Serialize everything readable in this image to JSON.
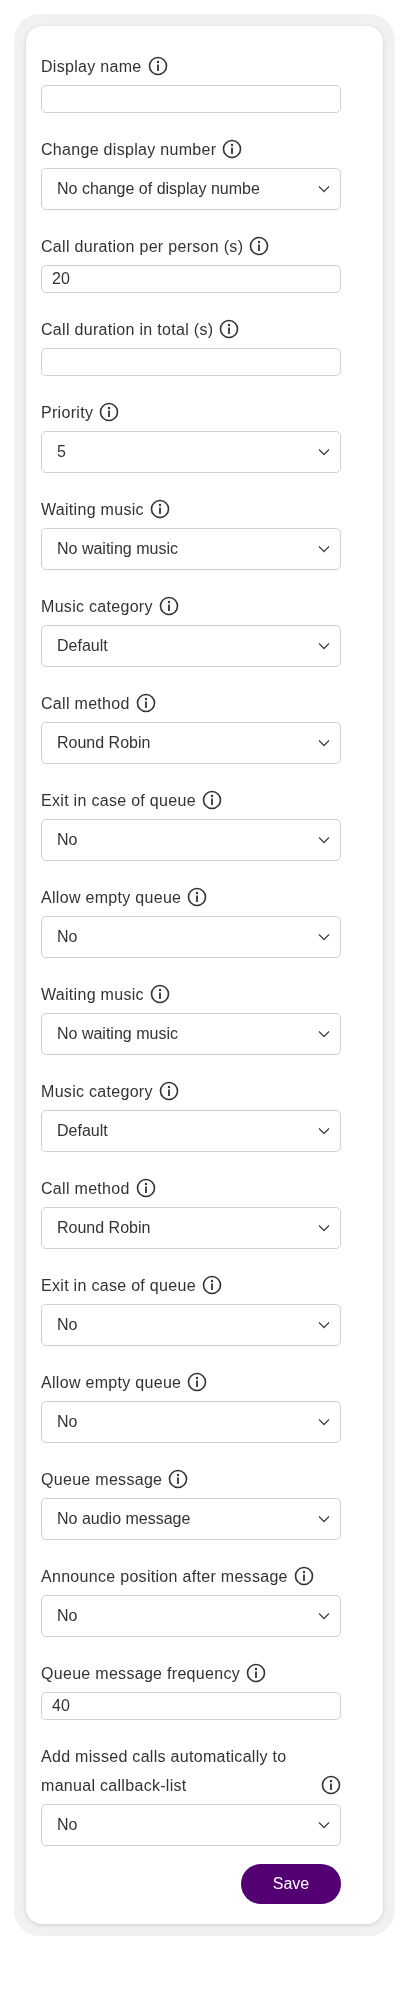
{
  "fields": [
    {
      "label": "Display name",
      "kind": "text"
    },
    {
      "label": "Change display number",
      "kind": "select",
      "value": "No change of display numbe"
    },
    {
      "label": "Call duration per person (s)",
      "kind": "text",
      "value": "20"
    },
    {
      "label": "Call duration in total (s)",
      "kind": "text"
    },
    {
      "label": "Priority",
      "kind": "select",
      "value": "5"
    },
    {
      "label": "Waiting music",
      "kind": "select",
      "value": "No waiting music"
    },
    {
      "label": "Music category",
      "kind": "select",
      "value": "Default"
    },
    {
      "label": "Call method",
      "kind": "select",
      "value": "Round Robin"
    },
    {
      "label": "Exit in case of queue",
      "kind": "select",
      "value": "No"
    },
    {
      "label": "Allow empty queue",
      "kind": "select",
      "value": "No"
    },
    {
      "label": "Waiting music",
      "kind": "select",
      "value": "No waiting music"
    },
    {
      "label": "Music category",
      "kind": "select",
      "value": "Default"
    },
    {
      "label": "Call method",
      "kind": "select",
      "value": "Round Robin"
    },
    {
      "label": "Exit in case of queue",
      "kind": "select",
      "value": "No"
    },
    {
      "label": "Allow empty queue",
      "kind": "select",
      "value": "No"
    },
    {
      "label": "Queue message",
      "kind": "select",
      "value": "No audio message"
    },
    {
      "label": "Announce position after message",
      "kind": "select",
      "value": "No"
    },
    {
      "label": "Queue message frequency",
      "kind": "text",
      "value": "40"
    },
    {
      "label": "Add missed calls automatically to manual callback-list",
      "kind": "select",
      "value": "No"
    }
  ],
  "save_button": "Save"
}
